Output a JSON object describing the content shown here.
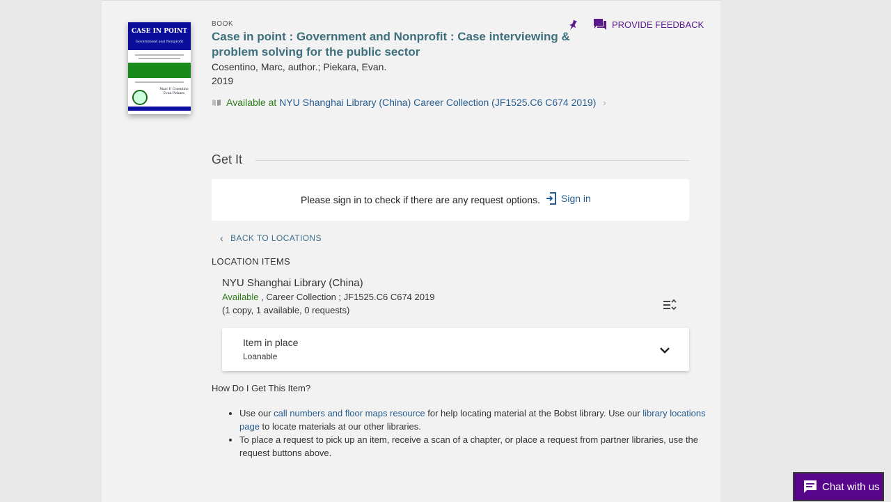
{
  "record": {
    "type": "BOOK",
    "title": "Case in point : Government and Nonprofit : Case interviewing & problem solving for the public sector",
    "authors": "Cosentino, Marc, author.; Piekara, Evan.",
    "year": "2019",
    "availability_status": "Available at",
    "availability_location": "NYU Shanghai Library (China)  Career Collection (JF1525.C6 C674 2019)",
    "cover": {
      "title": "CASE IN POINT",
      "subtitle": "Government and Nonprofit",
      "authors_line1": "Marc P. Cosentino",
      "authors_line2": "Evan Piekara"
    }
  },
  "actions": {
    "feedback_label": "PROVIDE FEEDBACK"
  },
  "getit": {
    "heading": "Get It",
    "signin_message": "Please sign in to check if there are any request options.",
    "signin_label": "Sign in",
    "back_label": "BACK TO LOCATIONS",
    "location_items_label": "LOCATION ITEMS",
    "location": {
      "name": "NYU Shanghai Library (China)",
      "status": "Available",
      "details": " , Career Collection ; JF1525.C6 C674 2019",
      "copies": "(1 copy, 1 available, 0 requests)"
    },
    "item": {
      "status": "Item in place",
      "policy": "Loanable"
    }
  },
  "howto": {
    "heading": "How Do I Get This Item?",
    "bullet1_pre": "Use our ",
    "bullet1_link1": "call numbers and floor maps resource",
    "bullet1_mid": " for help locating material at the Bobst library. Use our ",
    "bullet1_link2": "library locations page",
    "bullet1_post": " to locate materials at our other libraries.",
    "bullet2": "To place a request to pick up an item, receive a scan of a chapter, or place a request from partner libraries, use the request buttons above."
  },
  "chat": {
    "label": "Chat with us"
  },
  "colors": {
    "brand_purple": "#57068c",
    "link_blue": "#265c8f",
    "available_green": "#2e7d1a",
    "title_teal": "#3e6f7d"
  }
}
